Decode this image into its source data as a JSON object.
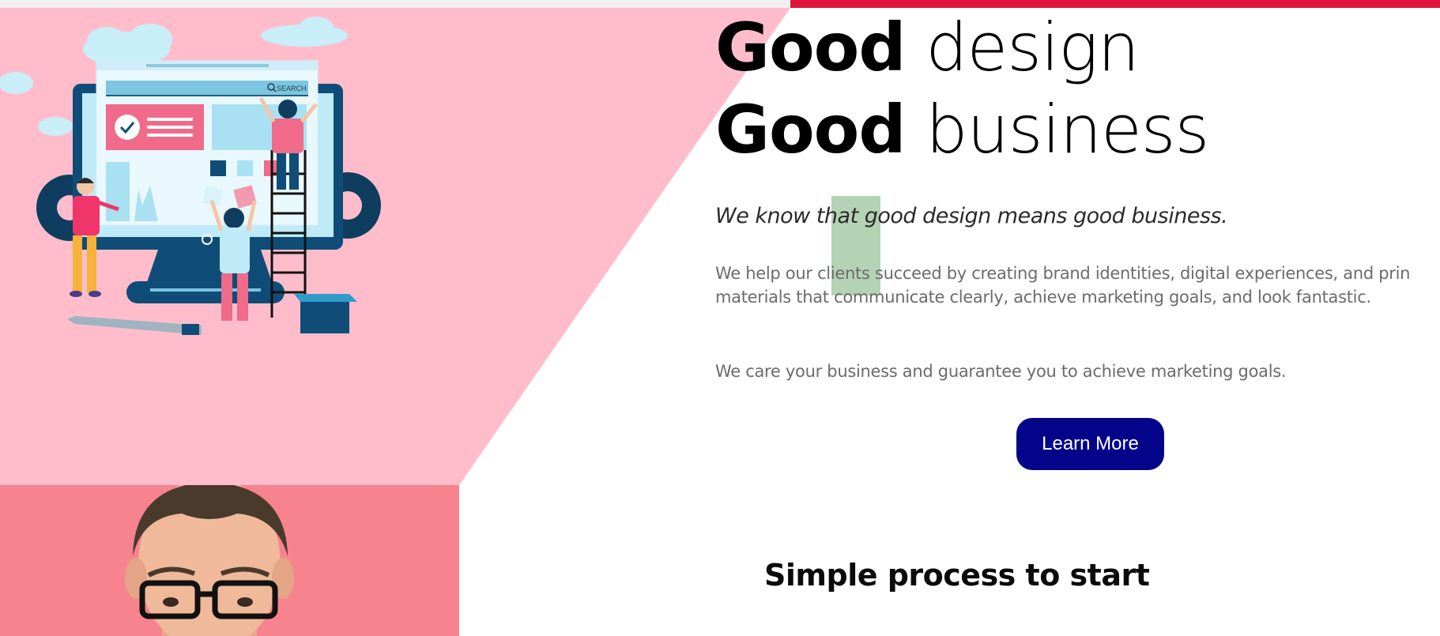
{
  "colors": {
    "pink_bg": "#ffbdcb",
    "red_accent": "#e0163d",
    "button_bg": "#04048a",
    "portrait_bg": "#f7838f",
    "highlight": "#9fc59f"
  },
  "hero": {
    "headline_line1_bold": "Good",
    "headline_line1_light": "design",
    "headline_line2_bold": "Good",
    "headline_line2_light": "business",
    "tagline": "We know that good design means good business.",
    "paragraph1_line1": "We help our clients succeed by creating brand identities, digital experiences, and prin",
    "paragraph1_line2": "materials that communicate clearly, achieve marketing goals, and look fantastic.",
    "paragraph2": "We care your business and guarantee you to achieve marketing goals.",
    "cta_label": "Learn More"
  },
  "illustration": {
    "search_label": "SEARCH",
    "icons": [
      "cloud-icon",
      "monitor-icon",
      "gear-icon",
      "ladder-icon",
      "box-icon",
      "pen-icon",
      "search-icon",
      "check-icon"
    ]
  },
  "process": {
    "title": "Simple process to start"
  }
}
